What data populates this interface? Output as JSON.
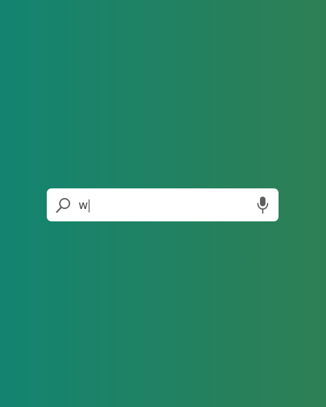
{
  "background": {
    "gradient_start": "#138471",
    "gradient_end": "#2e7f54"
  },
  "search": {
    "value": "w",
    "icon_left": "search-icon",
    "icon_right": "microphone-icon"
  },
  "colors": {
    "field_background": "#ffffff",
    "icon_color": "#5f5f5f",
    "text_color": "#444444"
  }
}
